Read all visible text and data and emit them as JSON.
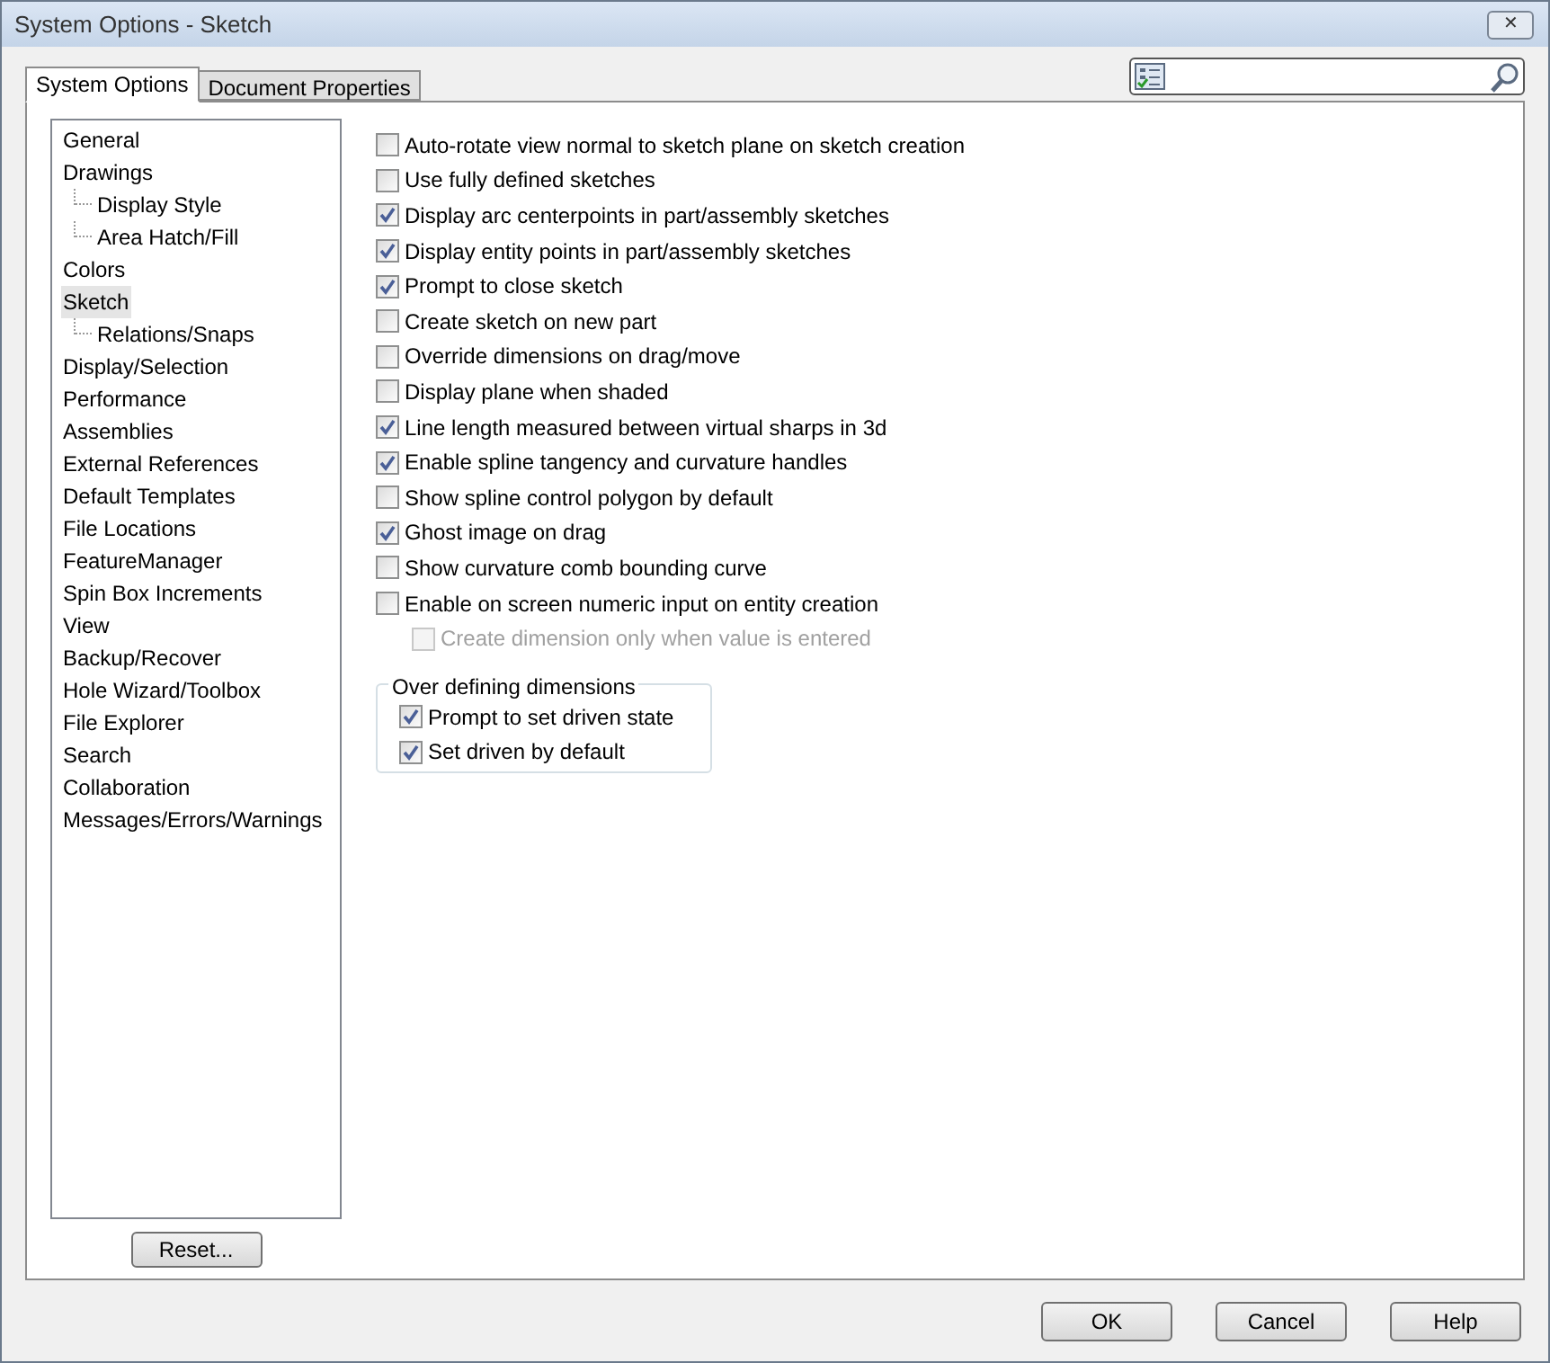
{
  "window": {
    "title": "System Options - Sketch",
    "close": "✕"
  },
  "tabs": [
    {
      "label": "System Options",
      "selected": true
    },
    {
      "label": "Document Properties",
      "selected": false
    }
  ],
  "tree": [
    {
      "label": "General",
      "selected": false
    },
    {
      "label": "Drawings",
      "selected": false,
      "children": [
        {
          "label": "Display Style",
          "selected": false
        },
        {
          "label": "Area Hatch/Fill",
          "selected": false
        }
      ]
    },
    {
      "label": "Colors",
      "selected": false
    },
    {
      "label": "Sketch",
      "selected": true,
      "children": [
        {
          "label": "Relations/Snaps",
          "selected": false
        }
      ]
    },
    {
      "label": "Display/Selection",
      "selected": false
    },
    {
      "label": "Performance",
      "selected": false
    },
    {
      "label": "Assemblies",
      "selected": false
    },
    {
      "label": "External References",
      "selected": false
    },
    {
      "label": "Default Templates",
      "selected": false
    },
    {
      "label": "File Locations",
      "selected": false
    },
    {
      "label": "FeatureManager",
      "selected": false
    },
    {
      "label": "Spin Box Increments",
      "selected": false
    },
    {
      "label": "View",
      "selected": false
    },
    {
      "label": "Backup/Recover",
      "selected": false
    },
    {
      "label": "Hole Wizard/Toolbox",
      "selected": false
    },
    {
      "label": "File Explorer",
      "selected": false
    },
    {
      "label": "Search",
      "selected": false
    },
    {
      "label": "Collaboration",
      "selected": false
    },
    {
      "label": "Messages/Errors/Warnings",
      "selected": false
    }
  ],
  "reset_button": "Reset...",
  "options": [
    {
      "label": "Auto-rotate view normal to sketch plane on sketch creation",
      "checked": false,
      "disabled": false
    },
    {
      "label": "Use fully defined sketches",
      "checked": false,
      "disabled": false
    },
    {
      "label": "Display arc centerpoints in part/assembly sketches",
      "checked": true,
      "disabled": false
    },
    {
      "label": "Display entity points in part/assembly sketches",
      "checked": true,
      "disabled": false
    },
    {
      "label": "Prompt to close sketch",
      "checked": true,
      "disabled": false
    },
    {
      "label": "Create sketch on new part",
      "checked": false,
      "disabled": false
    },
    {
      "label": "Override dimensions on drag/move",
      "checked": false,
      "disabled": false
    },
    {
      "label": "Display plane when shaded",
      "checked": false,
      "disabled": false
    },
    {
      "label": "Line length measured between virtual sharps in 3d",
      "checked": true,
      "disabled": false
    },
    {
      "label": "Enable spline tangency and curvature handles",
      "checked": true,
      "disabled": false
    },
    {
      "label": "Show spline control polygon by default",
      "checked": false,
      "disabled": false
    },
    {
      "label": "Ghost image on drag",
      "checked": true,
      "disabled": false
    },
    {
      "label": "Show curvature comb bounding curve",
      "checked": false,
      "disabled": false
    },
    {
      "label": "Enable on screen numeric input on entity creation",
      "checked": false,
      "disabled": false,
      "children": [
        {
          "label": "Create dimension only when value is entered",
          "checked": false,
          "disabled": true
        }
      ]
    }
  ],
  "group": {
    "title": "Over defining dimensions",
    "options": [
      {
        "label": "Prompt to set driven state",
        "checked": true,
        "disabled": false
      },
      {
        "label": "Set driven by default",
        "checked": true,
        "disabled": false
      }
    ]
  },
  "buttons": [
    "OK",
    "Cancel",
    "Help"
  ]
}
